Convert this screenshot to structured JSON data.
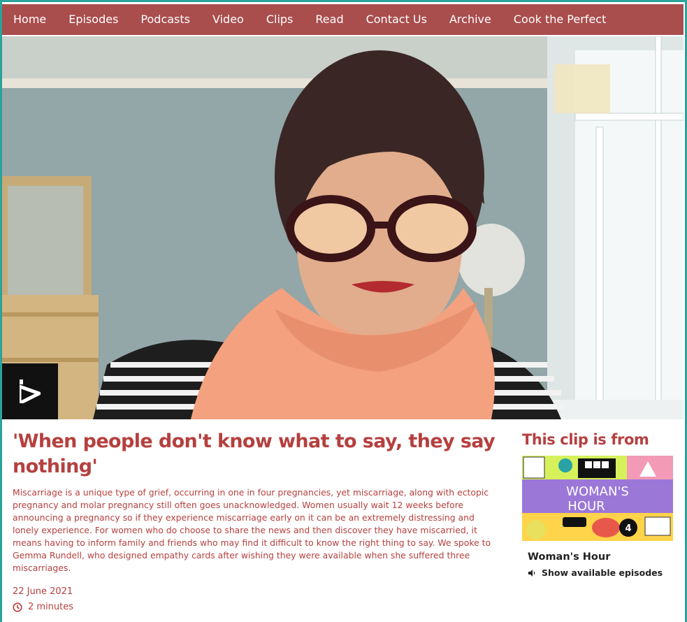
{
  "nav": {
    "items": [
      "Home",
      "Episodes",
      "Podcasts",
      "Video",
      "Clips",
      "Read",
      "Contact Us",
      "Archive",
      "Cook the Perfect"
    ]
  },
  "hero": {
    "play_icon": "iplayer-play-icon"
  },
  "clip": {
    "title": "'When people don't know what to say, they say nothing'",
    "description": "Miscarriage is a unique type of grief, occurring in one in four pregnancies, yet miscarriage, along with ectopic pregnancy and molar pregnancy still often goes unacknowledged. Women usually wait 12 weeks before announcing a pregnancy so if they experience miscarriage early on it can be an extremely distressing and lonely experience. For women who do choose to share the news and then discover they have miscarried, it means having to inform family and friends who may find it difficult to know the right thing to say. We spoke to Gemma Rundell, who designed empathy cards after wishing they were available when she suffered three miscarriages.",
    "date": "22 June 2021",
    "duration": "2 minutes"
  },
  "sidebar": {
    "heading": "This clip is from",
    "image_title_line1": "WOMAN'S",
    "image_title_line2": "HOUR",
    "image_brand": "BBC",
    "image_channel": "4",
    "programme": "Woman's Hour",
    "episodes_link": "Show available episodes"
  },
  "colors": {
    "accent": "#b5403f",
    "nav_bg": "#a94d4d",
    "frame": "#2aa39a"
  }
}
